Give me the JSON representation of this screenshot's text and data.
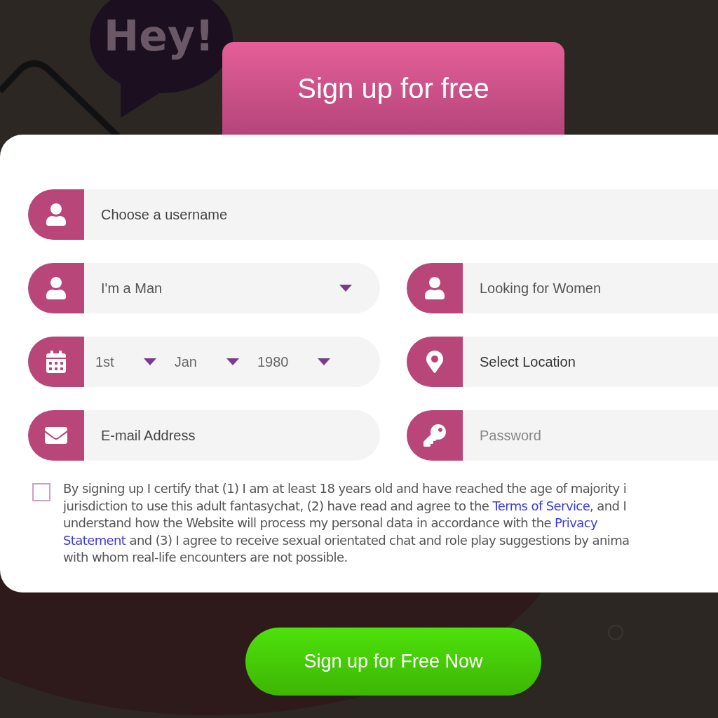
{
  "background": {
    "bubble_text": "Hey!"
  },
  "header": {
    "title": "Sign up for free"
  },
  "form": {
    "username": {
      "placeholder": "Choose a username"
    },
    "gender": {
      "value": "I'm a Man"
    },
    "seeking": {
      "value": "Looking for Women"
    },
    "birthdate": [
      {
        "value": "1st"
      },
      {
        "value": "Jan"
      },
      {
        "value": "1980"
      }
    ],
    "location": {
      "value": "Select Location"
    },
    "email": {
      "placeholder": "E-mail Address"
    },
    "password": {
      "placeholder": "Password"
    },
    "consent": {
      "checked": false,
      "lines": [
        [
          {
            "text": "By signing up I certify that (1) I am at least 18 years old and have reached the age of majority i",
            "link": false
          }
        ],
        [
          {
            "text": "jurisdiction to use this adult fantasychat, (2) have read and agree to the ",
            "link": false
          },
          {
            "text": "Terms of Service",
            "link": true
          },
          {
            "text": ", and I",
            "link": false
          }
        ],
        [
          {
            "text": "understand how the Website will process my personal data in accordance with the ",
            "link": false
          },
          {
            "text": "Privacy",
            "link": true
          }
        ],
        [
          {
            "text": "Statement",
            "link": true
          },
          {
            "text": " and (3) I agree to receive sexual orientated chat and role play suggestions by anima",
            "link": false
          }
        ],
        [
          {
            "text": "with whom real-life encounters are not possible.",
            "link": false
          }
        ]
      ]
    }
  },
  "submit": {
    "label": "Sign up for Free Now"
  }
}
